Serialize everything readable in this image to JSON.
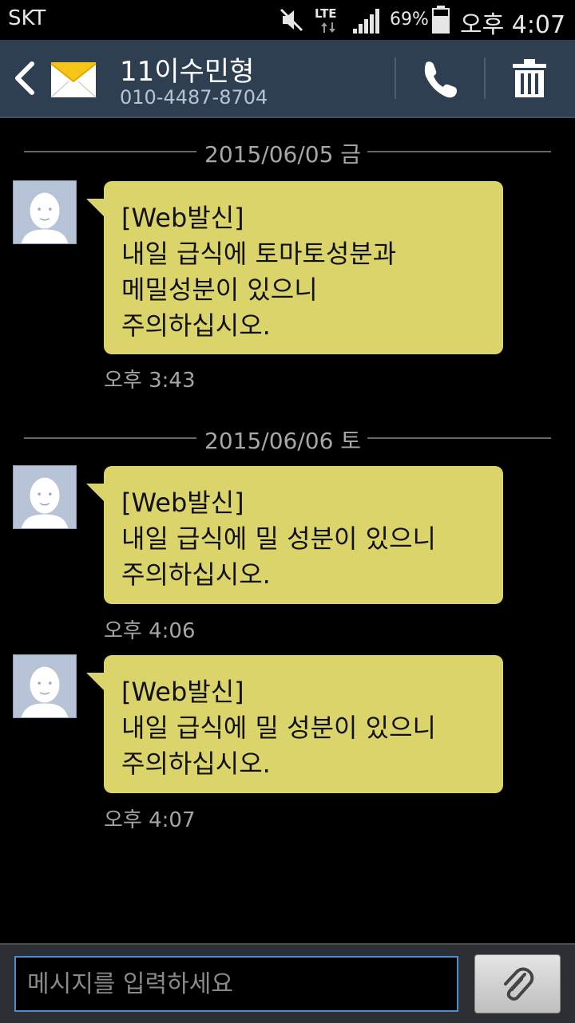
{
  "status_bar": {
    "carrier": "SKT",
    "network": "LTE",
    "battery": "69%",
    "time": "오후 4:07",
    "icons": [
      "mute-icon",
      "lte-icon",
      "signal-icon",
      "battery-icon"
    ]
  },
  "header": {
    "contact_name": "11이수민형",
    "contact_number": "010-4487-8704",
    "icons": [
      "back-icon",
      "envelope-icon",
      "call-icon",
      "trash-icon"
    ],
    "background": "#2f3f52"
  },
  "conversation": {
    "groups": [
      {
        "date": "2015/06/05 금",
        "messages": [
          {
            "lines": [
              "[Web발신]",
              "내일 급식에 토마토성분과",
              "메밀성분이 있으니",
              "주의하십시오."
            ],
            "time": "오후 3:43"
          }
        ]
      },
      {
        "date": "2015/06/06 토",
        "messages": [
          {
            "lines": [
              "[Web발신]",
              "내일 급식에 밀 성분이 있으니",
              "주의하십시오."
            ],
            "time": "오후 4:06"
          },
          {
            "lines": [
              "[Web발신]",
              "내일 급식에 밀 성분이 있으니",
              "주의하십시오."
            ],
            "time": "오후 4:07"
          }
        ]
      }
    ],
    "bubble_color": "#dbd46b"
  },
  "composer": {
    "placeholder": "메시지를 입력하세요",
    "value": "",
    "attach_icon": "paperclip-icon"
  }
}
